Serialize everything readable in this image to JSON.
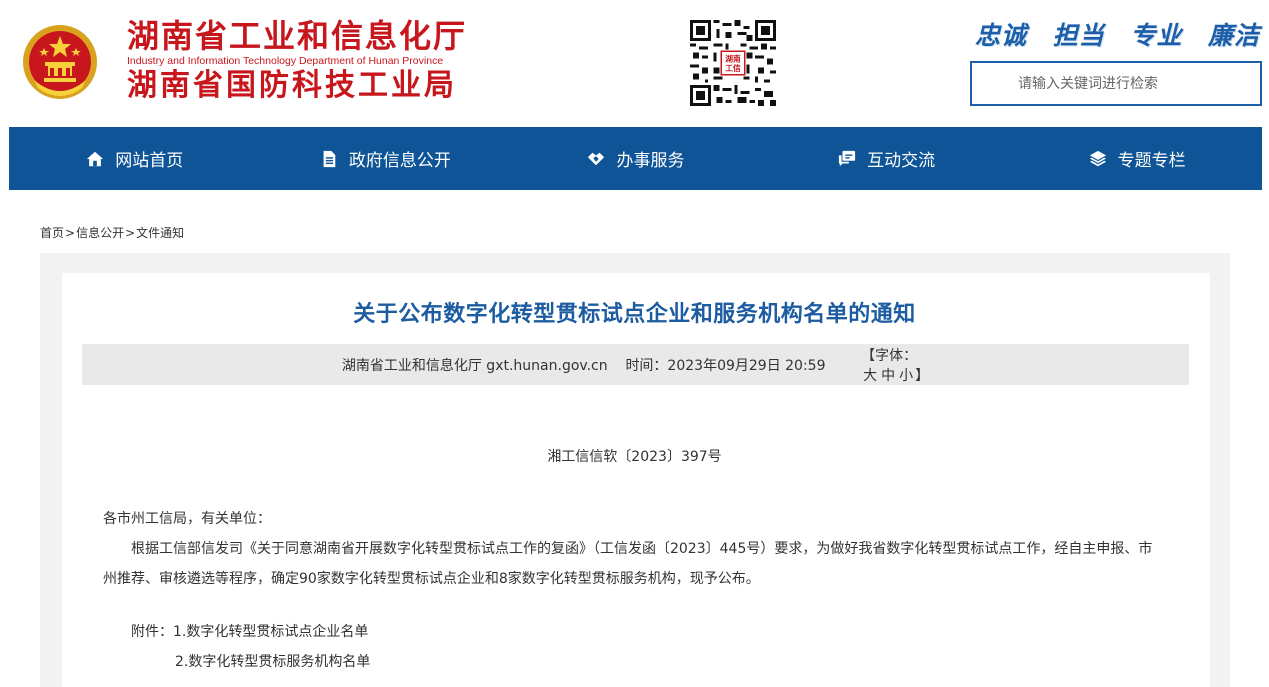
{
  "header": {
    "title_cn": "湖南省工业和信息化厅",
    "title_en": "Industry and Information Technology Department of Hunan Province",
    "title_cn2": "湖南省国防科技工业局",
    "slogans": [
      "忠诚",
      "担当",
      "专业",
      "廉洁"
    ],
    "search_placeholder": "请输入关键词进行检索",
    "qr_caption": "湖南工信"
  },
  "nav": {
    "items": [
      {
        "label": "网站首页",
        "icon": "home-icon"
      },
      {
        "label": "政府信息公开",
        "icon": "document-icon"
      },
      {
        "label": "办事服务",
        "icon": "handshake-icon"
      },
      {
        "label": "互动交流",
        "icon": "chat-icon"
      },
      {
        "label": "专题专栏",
        "icon": "layers-icon"
      }
    ]
  },
  "breadcrumb": {
    "home": "首页",
    "sep": ">",
    "section": "信息公开",
    "current": "文件通知"
  },
  "article": {
    "title": "关于公布数字化转型贯标试点企业和服务机构名单的通知",
    "meta_source": "湖南省工业和信息化厅 gxt.hunan.gov.cn",
    "meta_time": "时间：2023年09月29日 20:59",
    "font_prefix": "【字体：",
    "font_large": "大",
    "font_medium": "中",
    "font_small": "小",
    "font_suffix": "】",
    "doc_number": "湘工信信软〔2023〕397号",
    "salutation": "各市州工信局，有关单位：",
    "paragraph": "根据工信部信发司《关于同意湖南省开展数字化转型贯标试点工作的复函》（工信发函〔2023〕445号）要求，为做好我省数字化转型贯标试点工作，经自主申报、市州推荐、审核遴选等程序，确定90家数字化转型贯标试点企业和8家数字化转型贯标服务机构，现予公布。",
    "attachments_label": "附件：",
    "attachment1": "1.数字化转型贯标试点企业名单",
    "attachment2": "2.数字化转型贯标服务机构名单"
  },
  "colors": {
    "brand_red": "#c8161d",
    "nav_blue": "#0e5496",
    "title_blue": "#1d5ca0"
  }
}
